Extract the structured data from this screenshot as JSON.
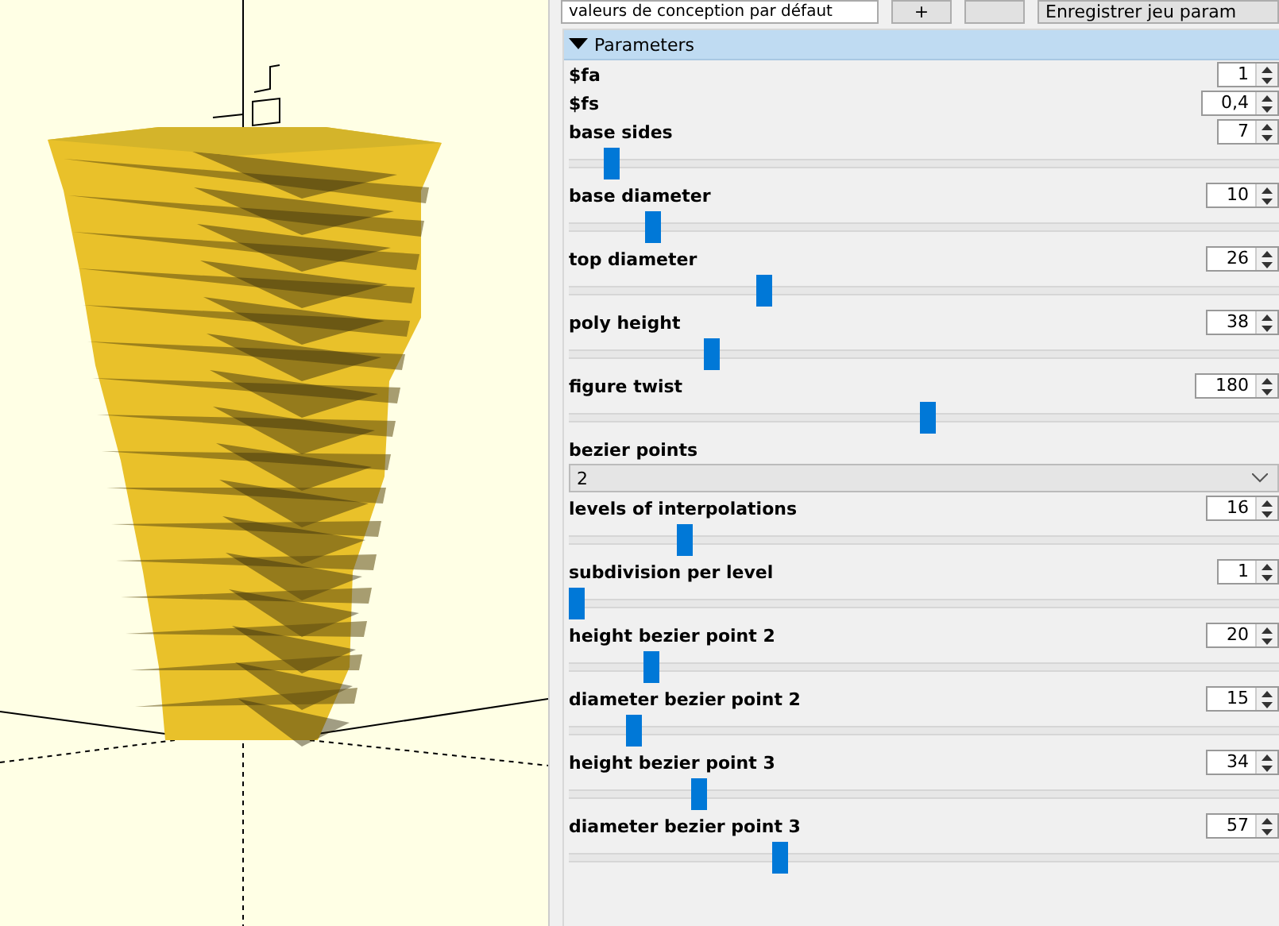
{
  "toolbar": {
    "preset_dropdown": "valeurs de conception par défaut",
    "add_button": "+",
    "save_button": "Enregistrer jeu param"
  },
  "parameters": {
    "title": "Parameters",
    "expanded": true,
    "items": [
      {
        "kind": "number",
        "label": "$fa",
        "value": "1"
      },
      {
        "kind": "number",
        "label": "$fs",
        "value": "0,4"
      },
      {
        "kind": "slider",
        "label": "base sides",
        "value": "7",
        "level": 0.05
      },
      {
        "kind": "slider",
        "label": "base diameter",
        "value": "10",
        "level": 0.11
      },
      {
        "kind": "slider",
        "label": "top diameter",
        "value": "26",
        "level": 0.27
      },
      {
        "kind": "slider",
        "label": "poly height",
        "value": "38",
        "level": 0.195
      },
      {
        "kind": "slider",
        "label": "figure twist",
        "value": "180",
        "level": 0.505
      },
      {
        "kind": "dropdown",
        "label": "bezier points",
        "value": "2"
      },
      {
        "kind": "slider",
        "label": "levels of interpolations",
        "value": "16",
        "level": 0.155
      },
      {
        "kind": "slider",
        "label": "subdivision per level",
        "value": "1",
        "level": 0.0
      },
      {
        "kind": "slider",
        "label": "height bezier point 2",
        "value": "20",
        "level": 0.107
      },
      {
        "kind": "slider",
        "label": "diameter bezier point 2",
        "value": "15",
        "level": 0.082
      },
      {
        "kind": "slider",
        "label": "height bezier point 3",
        "value": "34",
        "level": 0.177
      },
      {
        "kind": "slider",
        "label": "diameter bezier point 3",
        "value": "57",
        "level": 0.293
      }
    ]
  }
}
